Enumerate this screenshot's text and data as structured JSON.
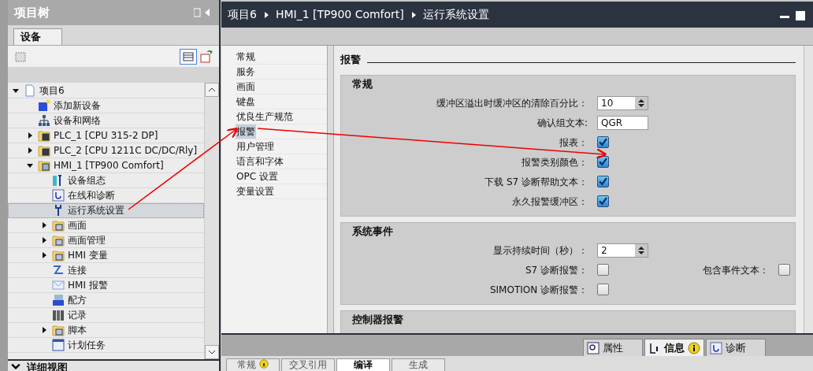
{
  "project_tree": {
    "title": "项目树",
    "tab": {
      "label": "设备",
      "selected": true
    },
    "items": [
      {
        "label": "项目6",
        "kind": "project",
        "expanded": true,
        "selected": false,
        "children": [
          {
            "label": "添加新设备",
            "kind": "add",
            "selected": false
          },
          {
            "label": "设备和网络",
            "kind": "network",
            "selected": false
          },
          {
            "label": "PLC_1 [CPU 315-2 DP]",
            "kind": "plc",
            "expanded": false,
            "selected": false
          },
          {
            "label": "PLC_2 [CPU 1211C DC/DC/Rly]",
            "kind": "plc",
            "expanded": false,
            "selected": false
          },
          {
            "label": "HMI_1 [TP900 Comfort]",
            "kind": "hmi",
            "expanded": true,
            "selected": false,
            "children": [
              {
                "label": "设备组态",
                "kind": "config",
                "selected": false
              },
              {
                "label": "在线和诊断",
                "kind": "diag",
                "selected": false
              },
              {
                "label": "运行系统设置",
                "kind": "wrench",
                "selected": true
              },
              {
                "label": "画面",
                "kind": "folder",
                "expanded": false,
                "selected": false
              },
              {
                "label": "画面管理",
                "kind": "folder",
                "expanded": false,
                "selected": false
              },
              {
                "label": "HMI 变量",
                "kind": "folder",
                "expanded": false,
                "selected": false
              },
              {
                "label": "连接",
                "kind": "connection",
                "selected": false
              },
              {
                "label": "HMI 报警",
                "kind": "mail",
                "selected": false
              },
              {
                "label": "配方",
                "kind": "recipe",
                "selected": false
              },
              {
                "label": "记录",
                "kind": "log",
                "selected": false
              },
              {
                "label": "脚本",
                "kind": "folder",
                "expanded": false,
                "selected": false
              },
              {
                "label": "计划任务",
                "kind": "schedule",
                "selected": false
              }
            ]
          }
        ]
      }
    ]
  },
  "details_view": {
    "title": "详细视图"
  },
  "editor": {
    "breadcrumb": [
      "项目6",
      "HMI_1 [TP900 Comfort]",
      "运行系统设置"
    ],
    "nav": [
      {
        "label": "常规",
        "selected": false
      },
      {
        "label": "服务",
        "selected": false
      },
      {
        "label": "画面",
        "selected": false
      },
      {
        "label": "键盘",
        "selected": false
      },
      {
        "label": "优良生产规范",
        "selected": false
      },
      {
        "label": "报警",
        "selected": true
      },
      {
        "label": "用户管理",
        "selected": false
      },
      {
        "label": "语言和字体",
        "selected": false
      },
      {
        "label": "OPC 设置",
        "selected": false
      },
      {
        "label": "变量设置",
        "selected": false
      }
    ],
    "heading": "报警",
    "groups": [
      {
        "title": "常规",
        "fields": [
          {
            "kind": "spin",
            "label": "缓冲区溢出时缓冲区的清除百分比：",
            "value": "10"
          },
          {
            "kind": "text",
            "label": "确认组文本:",
            "value": "QGR"
          },
          {
            "kind": "checkbox",
            "label": "报表：",
            "checked": true
          },
          {
            "kind": "checkbox",
            "label": "报警类别颜色：",
            "checked": true
          },
          {
            "kind": "checkbox",
            "label": "下载 S7 诊断帮助文本：",
            "checked": true
          },
          {
            "kind": "checkbox",
            "label": "永久报警缓冲区：",
            "checked": true
          }
        ]
      },
      {
        "title": "系统事件",
        "fields": [
          {
            "kind": "spin",
            "label": "显示持续时间（秒）：",
            "value": "2"
          },
          {
            "kind": "checkbox",
            "label": "S7 诊断报警：",
            "checked": false,
            "side": {
              "label": "包含事件文本：",
              "checked": false
            }
          },
          {
            "kind": "checkbox",
            "label": "SIMOTION 诊断报警：",
            "checked": false
          }
        ]
      },
      {
        "title": "控制器报警"
      }
    ]
  },
  "inspector_tabs": [
    {
      "label": "属性",
      "kind": "properties",
      "selected": false
    },
    {
      "label": "信息",
      "kind": "info",
      "selected": true
    },
    {
      "label": "诊断",
      "kind": "diagnostics",
      "selected": false
    }
  ],
  "info_tabs": [
    {
      "label": "常规",
      "selected": false,
      "info": true
    },
    {
      "label": "交叉引用",
      "selected": false,
      "info": false
    },
    {
      "label": "编译",
      "selected": true,
      "info": false
    },
    {
      "label": "生成",
      "selected": false,
      "info": false
    }
  ]
}
